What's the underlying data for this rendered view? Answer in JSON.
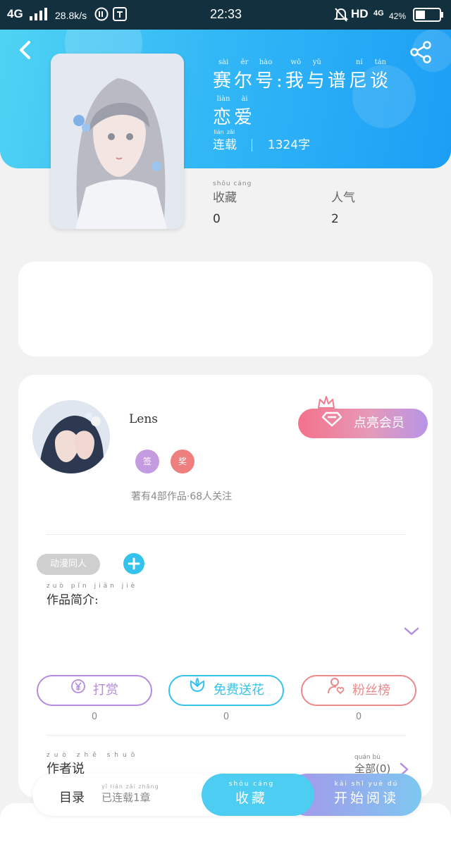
{
  "status_bar": {
    "network": "4G",
    "speed": "28.8k/s",
    "time": "22:33",
    "hd": "HD",
    "signal_type": "4G",
    "battery_pct": "42%",
    "battery_level": 0.42
  },
  "header": {
    "back_icon": "chevron-left-icon",
    "share_icon": "share-icon",
    "title_line1": [
      "赛",
      "尔",
      "号",
      ":",
      "我",
      "与",
      "谱",
      "尼",
      "谈"
    ],
    "title_line1_pinyin": [
      "sài",
      "ěr",
      "hào",
      "",
      "wǒ",
      "yǔ",
      "",
      "ní",
      "tán"
    ],
    "title_line2": [
      "恋",
      "爱"
    ],
    "title_line2_pinyin": [
      "liàn",
      "ài"
    ],
    "status_chars": [
      "连",
      "载"
    ],
    "status_pinyin": [
      "lián",
      "zǎi"
    ],
    "word_count": "1324字"
  },
  "stats": {
    "favorites_label": "收藏",
    "favorites_pinyin": "shōu cáng",
    "favorites_value": "0",
    "popularity_label": "人气",
    "popularity_value": "2"
  },
  "author": {
    "name": "Lens",
    "badge1": "签",
    "badge2": "奖",
    "summary": "著有4部作品·68人关注",
    "vip_label": "点亮会员",
    "crown_icon": "crown-icon",
    "diamond_icon": "diamond-icon"
  },
  "work": {
    "tag": "动漫同人",
    "add_icon": "plus-icon",
    "intro_label": "作品简介:",
    "intro_pinyin": [
      "zuò",
      "pǐn",
      "jiǎn",
      "jiè"
    ],
    "expand_icon": "chevron-down-icon"
  },
  "actions": [
    {
      "label": "打赏",
      "icon": "yen-icon",
      "count": "0",
      "color": "#b58be0"
    },
    {
      "label": "免费送花",
      "icon": "flower-icon",
      "count": "0",
      "color": "#35c3ec"
    },
    {
      "label": "粉丝榜",
      "icon": "user-heart-icon",
      "count": "0",
      "color": "#e98a8a"
    }
  ],
  "author_says": {
    "label": "作者说",
    "pinyin": [
      "zuò",
      "zhě",
      "shuō"
    ],
    "all_label": "全部(0)",
    "all_pinyin": "quán bù",
    "arrow_icon": "chevron-right-icon"
  },
  "bottom": {
    "catalog": "目录",
    "chapters": "已连载1章",
    "chapters_pinyin": "yǐ lián zǎi zhāng",
    "favorite": "收藏",
    "favorite_pinyin": "shōu cáng",
    "read": "开始阅读",
    "read_pinyin": "kāi shǐ yuè dú"
  },
  "colors": {
    "header_start": "#4fd3f3",
    "header_end": "#1c9ef5",
    "vip_start": "#f4718a",
    "vip_end": "#b894e8",
    "favorite_btn": "#4ccdf1",
    "read_btn_start": "#a696ea",
    "tag_bg": "#cfcfcf"
  }
}
